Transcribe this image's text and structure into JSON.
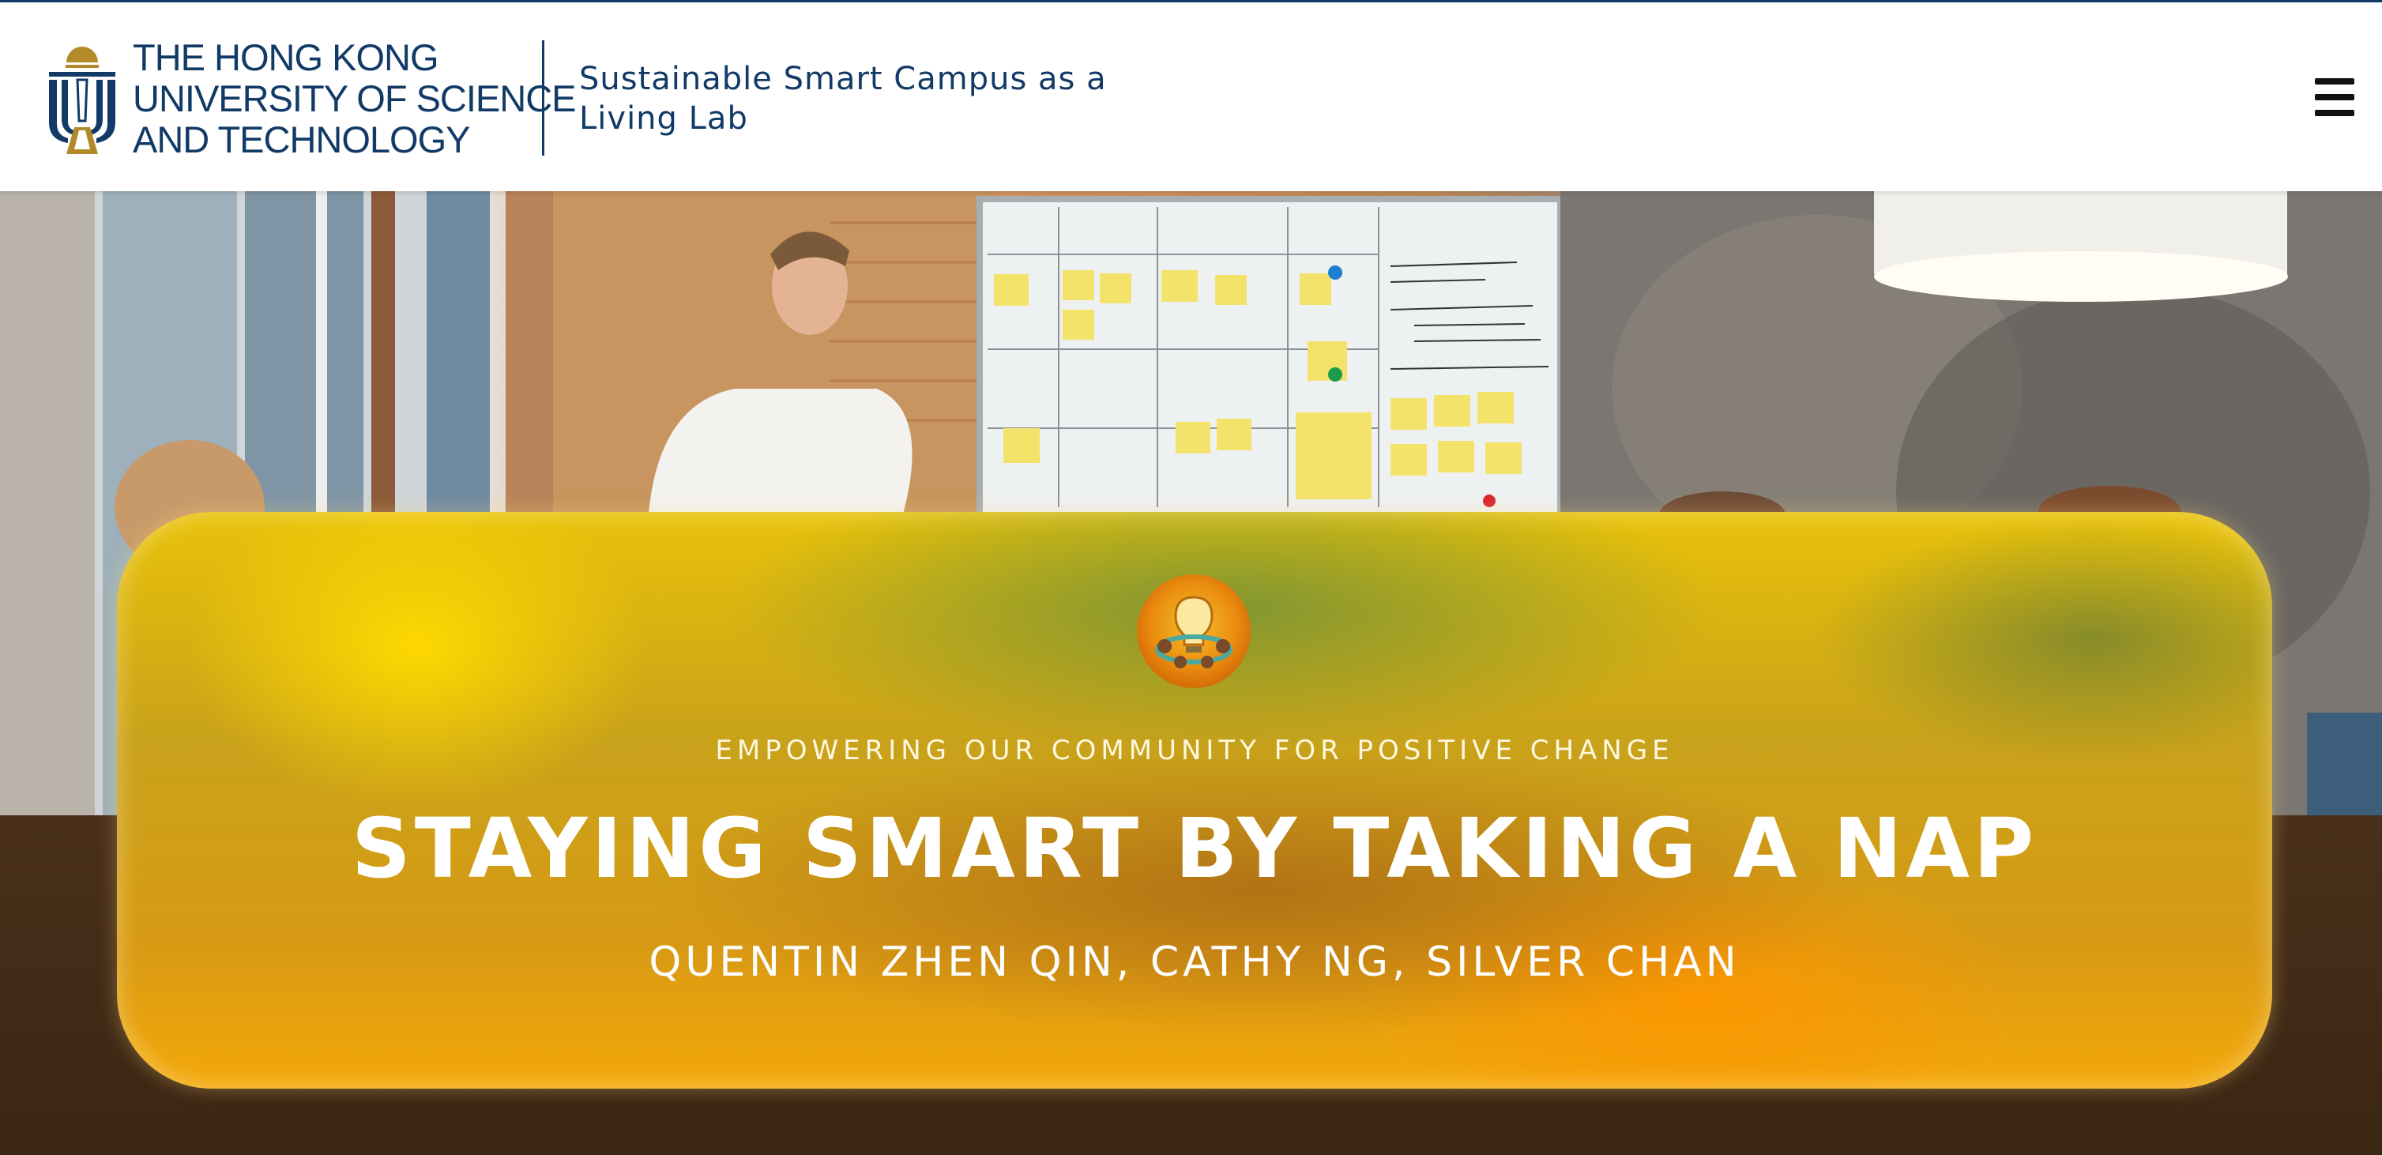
{
  "header": {
    "university_lines": [
      "THE HONG KONG",
      "UNIVERSITY OF SCIENCE",
      "AND TECHNOLOGY"
    ],
    "site_title": "Sustainable Smart Campus as a Living Lab",
    "menu_icon": "hamburger-menu-icon"
  },
  "hero": {
    "photo_description_icon": "office-whiteboard-photo",
    "eyebrow": "EMPOWERING OUR COMMUNITY FOR POSITIVE CHANGE",
    "title": "STAYING SMART BY TAKING A NAP",
    "authors": "QUENTIN ZHEN QIN, CATHY NG, SILVER CHAN",
    "icon": "lightbulb-badge-icon"
  },
  "colors": {
    "brand_navy": "#123a66",
    "brand_gold": "#b28a2a",
    "card_yellow": "#e8c20a",
    "card_orange": "#f4a80a"
  }
}
